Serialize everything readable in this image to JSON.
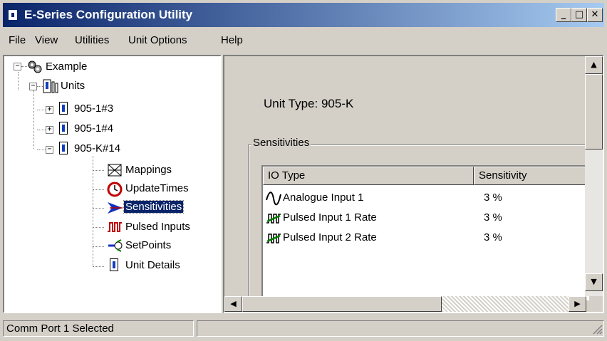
{
  "window": {
    "title": "E-Series Configuration Utility",
    "minimize": "_",
    "maximize": "□",
    "close": "✕"
  },
  "menu": [
    "File",
    "View",
    "Utilities",
    "Unit Options",
    "Help"
  ],
  "tree": {
    "root": "Example",
    "units": "Units",
    "unit_a": "905-1#3",
    "unit_b": "905-1#4",
    "unit_c": "905-K#14",
    "children": [
      "Mappings",
      "UpdateTimes",
      "Sensitivities",
      "Pulsed Inputs",
      "SetPoints",
      "Unit Details"
    ],
    "selected": "Sensitivities"
  },
  "detail": {
    "unit_type": "Unit Type: 905-K",
    "group_label": "Sensitivities",
    "columns": [
      "IO Type",
      "Sensitivity"
    ],
    "rows": [
      {
        "name": "Analogue Input 1",
        "value": "3 %",
        "icon": "analogue-wave-icon"
      },
      {
        "name": "Pulsed Input 1 Rate",
        "value": "3 %",
        "icon": "pulse-icon"
      },
      {
        "name": "Pulsed Input 2 Rate",
        "value": "3 %",
        "icon": "pulse-icon"
      }
    ]
  },
  "status": {
    "message": "Comm Port 1 Selected"
  },
  "colors": {
    "titlebar_start": "#0a246a",
    "titlebar_end": "#a6caf0",
    "selection": "#0a246a",
    "face": "#d4d0c8"
  }
}
